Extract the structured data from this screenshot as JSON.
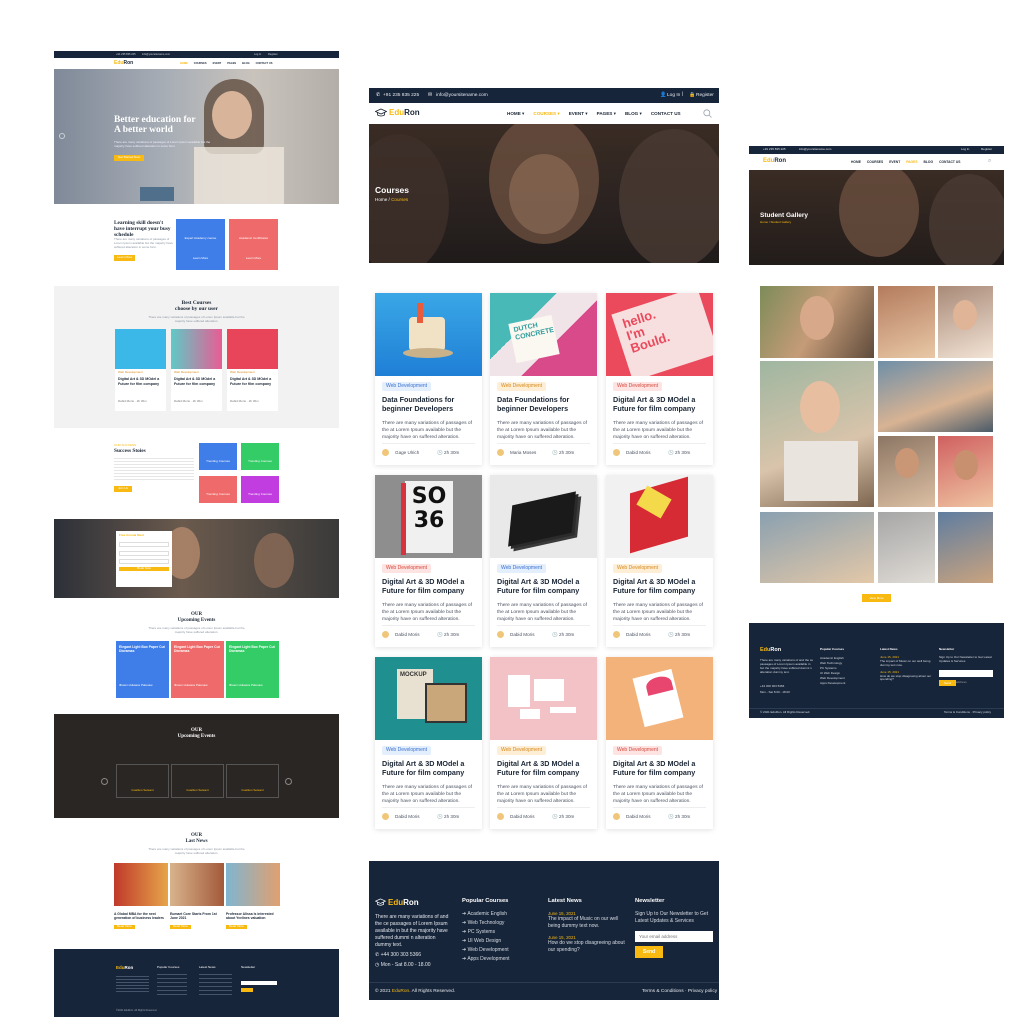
{
  "brand": {
    "name_edu": "Edu",
    "name_ron": "Ron"
  },
  "topbar": {
    "phone": "+91 235 835 225",
    "email": "info@yoursitename.com",
    "login": "Log In",
    "register": "Register"
  },
  "nav": [
    "HOME",
    "COURSES",
    "EVENT",
    "PAGES",
    "BLOG",
    "CONTACT US"
  ],
  "colors": {
    "navy": "#17253a",
    "accent": "#f8b910",
    "blue": "#3f7de8",
    "coral": "#ef6a6a",
    "green": "#33cc66",
    "purple": "#c13de0"
  },
  "left": {
    "hero_title_1": "Better education for",
    "hero_title_2": "A better world",
    "hero_text": "There are many variations of passages of Lorem Ipsum available but the majority have suffered alteration in some form.",
    "hero_button": "Get Started Now",
    "intro_title": "Learning skill doesn't have interrupt your busy schedule",
    "intro_text": "There are many variations of passages of Lorem Ipsum available but the majority have suffered alteration in some form.",
    "intro_button": "Learn More",
    "box1_title": "Expert Academy course",
    "box2_title": "Academic Certificates",
    "box_link": "Learn More",
    "best_title_1": "Best Courses",
    "best_title_2": "choose by our user",
    "best_text": "There are many variations of passages of Lorem Ipsum available but the majority have suffered alteration.",
    "best_cards": [
      {
        "tag": "Web Development",
        "title": "Digital Art & 3D MOdel a Future for film company",
        "author": "Dabid Moris",
        "time": "2h 30m"
      },
      {
        "tag": "Web Development",
        "title": "Digital Art & 3D MOdel a Future for film company",
        "author": "Dabid Moris",
        "time": "2h 30m"
      },
      {
        "tag": "Web Development",
        "title": "Digital Art & 3D MOdel a Future for film company",
        "author": "Dabid Moris",
        "time": "2h 30m"
      }
    ],
    "success_kicker": "OUR SUCCESS",
    "success_title": "Success Stoies",
    "success_button": "Join Us",
    "trend_tiles": [
      "Trending Courses",
      "Trending Courses",
      "Trending Courses",
      "Trending Courses"
    ],
    "enroll_title": "Free Annual Meet",
    "enroll_button": "Book Now",
    "events_kicker": "OUR",
    "events_title": "Upcoming Events",
    "events_text": "There are many variations of passages of Lorem Ipsum available but the majority have suffered alteration.",
    "events": [
      {
        "title": "Elegant Light Box Paper Cut Dioramas",
        "foot": "Ilhasm Hukasss Palenaw"
      },
      {
        "title": "Elegant Light Box Paper Cut Dioramas",
        "foot": "Ilhasm Hukasss Palenaw"
      },
      {
        "title": "Elegant Light Box Paper Cut Dioramas",
        "foot": "Ilhasm Hukasss Palenaw"
      }
    ],
    "testi_kicker": "OUR",
    "testi_title": "Upcoming Events",
    "testi_names": [
      "Gualtion Seleant",
      "Gualtion Seleant",
      "Gualtion Seleant"
    ],
    "news_kicker": "OUR",
    "news_title": "Last News",
    "news_text": "There are many variations of passages of Lorem Ipsum available but the majority have suffered alteration.",
    "news": [
      {
        "title": "A Global MBA for the next generation of business leaders",
        "button": "Read More"
      },
      {
        "title": "Eumaet Core Starts From 1st June 2021",
        "button": "Read More"
      },
      {
        "title": "Professor Alissa is interested about Yvelines valuation",
        "button": "Read More"
      }
    ],
    "copyright": "©2021 EduRon. All Rights Reserved."
  },
  "middle": {
    "page_title": "Courses",
    "crumb_home": "Home",
    "crumb_current": "Courses",
    "cards": [
      {
        "tag": "Web Development",
        "title": "Data Foundations for beginner Developers",
        "desc": "There are many variations of passages of the at Lorem Ipsum available but the majority have on suffered alteration.",
        "author": "Gage Ulrich",
        "time": "2h 30m"
      },
      {
        "tag": "Web Development",
        "title": "Data Foundations for beginner Developers",
        "desc": "There are many variations of passages of the at Lorem Ipsum available but the majority have on suffered alteration.",
        "author": "Maria Moses",
        "time": "2h 30m"
      },
      {
        "tag": "Web Development",
        "title": "Digital Art & 3D MOdel a Future for film company",
        "desc": "There are many variations of passages of the at Lorem Ipsum available but the majority have on suffered alteration.",
        "author": "Dabid Moris",
        "time": "2h 30m"
      },
      {
        "tag": "Web Development",
        "title": "Digital Art & 3D MOdel a Future for film company",
        "desc": "There are many variations of passages of the at Lorem Ipsum available but the majority have on suffered alteration.",
        "author": "Dabid Moris",
        "time": "2h 30m"
      },
      {
        "tag": "Web Development",
        "title": "Digital Art & 3D MOdel a Future for film company",
        "desc": "There are many variations of passages of the at Lorem Ipsum available but the majority have on suffered alteration.",
        "author": "Dabid Moris",
        "time": "2h 30m"
      },
      {
        "tag": "Web Development",
        "title": "Digital Art & 3D MOdel a Future for film company",
        "desc": "There are many variations of passages of the at Lorem Ipsum available but the majority have on suffered alteration.",
        "author": "Dabid Moris",
        "time": "2h 30m"
      },
      {
        "tag": "Web Development",
        "title": "Digital Art & 3D MOdel a Future for film company",
        "desc": "There are many variations of passages of the at Lorem Ipsum available but the majority have on suffered alteration.",
        "author": "Dabid Moris",
        "time": "2h 30m"
      },
      {
        "tag": "Web Development",
        "title": "Digital Art & 3D MOdel a Future for film company",
        "desc": "There are many variations of passages of the at Lorem Ipsum available but the majority have on suffered alteration.",
        "author": "Dabid Moris",
        "time": "2h 30m"
      },
      {
        "tag": "Web Development",
        "title": "Digital Art & 3D MOdel a Future for film company",
        "desc": "There are many variations of passages of the at Lorem Ipsum available but the majority have on suffered alteration.",
        "author": "Dabid Moris",
        "time": "2h 30m"
      }
    ],
    "art": {
      "hello_1": "hello.",
      "hello_2": "I'm",
      "hello_3": "Bould.",
      "so": "SO",
      "thirtysix": "36",
      "dutch": "DUTCH",
      "concrete": "CONCRETE",
      "mockup": "MOCKUP"
    },
    "footer": {
      "about": "There are many variations of and the ce passages of Lorem Ipsum available in but the majority have suffered dummi n alteration dummy text.",
      "phone": "+44 300 303 5366",
      "hours": "Mon - Sat 8.00 - 18.00",
      "courses_title": "Popular Courses",
      "courses": [
        "Academic English",
        "Web Technology",
        "PC Systems",
        "UI Web Design",
        "Web Development",
        "Apps Development"
      ],
      "news_title": "Latest News",
      "news": [
        {
          "date": "June 15, 2021",
          "text": "The impact of Music on our well being dummy text now."
        },
        {
          "date": "June 15, 2021",
          "text": "How do we stop disagreeing about our spending?"
        }
      ],
      "newsletter_title": "Newsletter",
      "newsletter_text": "Sign Up to Our Newsletter to Get Latest Updates & Services",
      "email_placeholder": "Your email address",
      "send": "Send",
      "copyright_pre": "© 2021 ",
      "copyright_brand": "EduRon",
      "copyright_post": ". All Rights Reserved.",
      "legal": "Terms & Conditions · Privacy policy"
    }
  },
  "right": {
    "page_title": "Student Gallery",
    "crumb": "Home / Student Gallery",
    "view_more": "View More",
    "footer": {
      "about": "There are many variations of and the ce passages of Lorem Ipsum available in but the majority have suffered dummi n alteration dummy text.",
      "phone": "+44 300 303 5366",
      "hours": "Mon - Sat 8.00 - 18.00",
      "courses_title": "Popular Courses",
      "courses": [
        "Academic English",
        "Web Technology",
        "PC Systems",
        "UI Web Design",
        "Web Development",
        "Apps Development"
      ],
      "news_title": "Latest News",
      "news": [
        {
          "date": "June 15, 2021",
          "text": "The impact of Music on our well being dummy text now."
        },
        {
          "date": "June 15, 2021",
          "text": "How do we stop disagreeing about our spending?"
        }
      ],
      "newsletter_title": "Newsletter",
      "newsletter_text": "Sign Up to Our Newsletter to Get Latest Updates & Services",
      "email_placeholder": "Your email address",
      "send": "Send",
      "copyright": "© 2021 EduRon. All Rights Reserved.",
      "legal": "Terms & Conditions · Privacy policy"
    }
  }
}
